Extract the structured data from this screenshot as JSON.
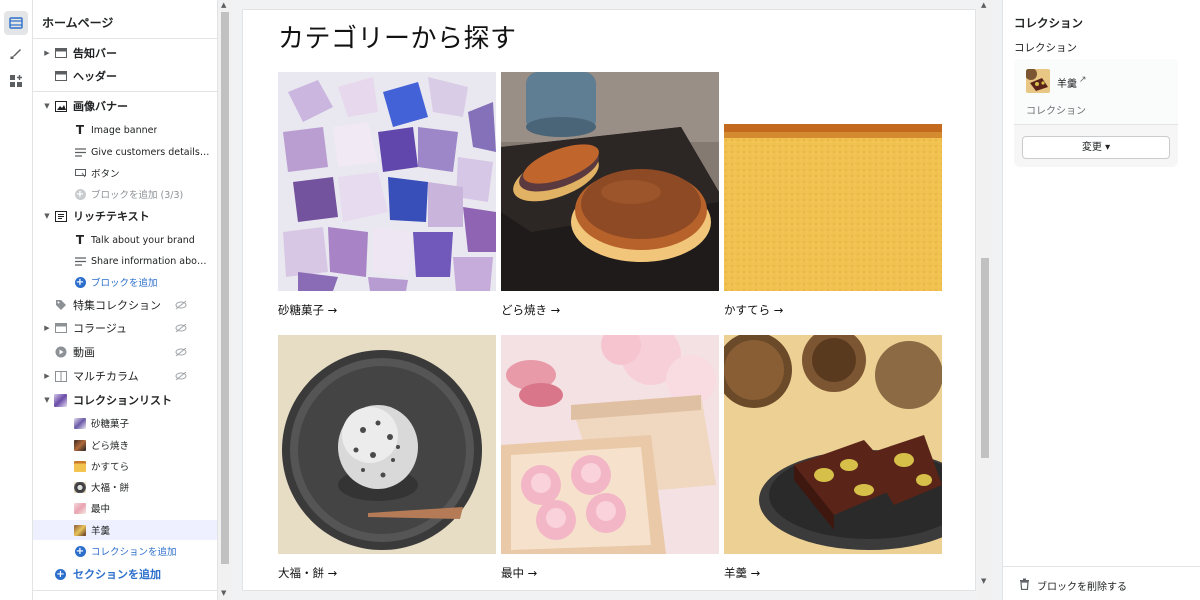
{
  "sidebar": {
    "title": "ホームページ",
    "sections": {
      "announcement": "告知バー",
      "header": "ヘッダー",
      "image_banner": "画像バナー",
      "image_banner_blocks": [
        "Image banner",
        "Give customers details abo...",
        "ボタン"
      ],
      "image_banner_add": "ブロックを追加 (3/3)",
      "rich_text": "リッチテキスト",
      "rich_text_blocks": [
        "Talk about your brand",
        "Share information about y..."
      ],
      "rich_text_add": "ブロックを追加",
      "featured_collection": "特集コレクション",
      "collage": "コラージュ",
      "video": "動画",
      "multicolumn": "マルチカラム",
      "collection_list": "コレクションリスト",
      "collection_blocks": [
        "砂糖菓子",
        "どら焼き",
        "かすてら",
        "大福・餅",
        "最中",
        "羊羹"
      ],
      "collection_add": "コレクションを追加",
      "add_section": "セクションを追加"
    }
  },
  "preview": {
    "heading": "カテゴリーから探す",
    "cards": [
      {
        "label": "砂糖菓子 →"
      },
      {
        "label": "どら焼き →"
      },
      {
        "label": "かすてら →"
      },
      {
        "label": "大福・餅 →"
      },
      {
        "label": "最中 →"
      },
      {
        "label": "羊羹 →"
      }
    ]
  },
  "right_panel": {
    "title": "コレクション",
    "subtitle": "コレクション",
    "selected_name": "羊羹",
    "selected_type": "コレクション",
    "change_button": "変更 ▾",
    "delete_block": "ブロックを削除する"
  },
  "colors": {
    "accent": "#2c6ecb",
    "selected_row": "#eef0ff"
  }
}
